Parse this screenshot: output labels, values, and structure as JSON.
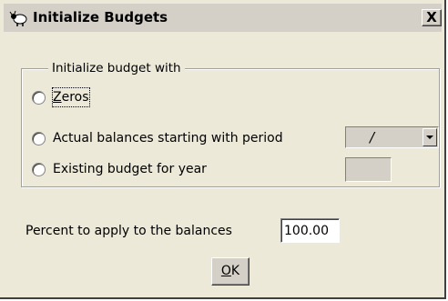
{
  "window": {
    "title": "Initialize Budgets",
    "close_label": "X"
  },
  "group": {
    "legend": "Initialize budget with",
    "options": [
      {
        "label_first": "Z",
        "label_rest": "eros",
        "selected": false,
        "focused": true
      },
      {
        "label": "Actual balances starting with period",
        "selected": false
      },
      {
        "label": "Existing budget for year",
        "selected": false
      }
    ],
    "period_value": "/",
    "year_value": ""
  },
  "percent": {
    "label": "Percent to apply to the balances",
    "value": "100.00"
  },
  "ok": {
    "label_first": "O",
    "label_rest": "K"
  },
  "colors": {
    "dialog_bg": "#ece9d8",
    "titlebar_bg": "#d4d0c8"
  },
  "icons": {
    "title_icon": "sheep-app-icon",
    "combo_arrow": "chevron-down-icon"
  }
}
